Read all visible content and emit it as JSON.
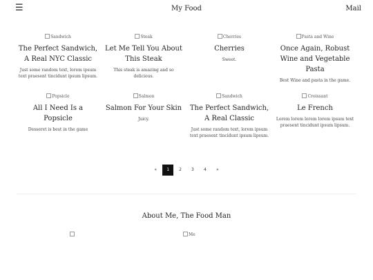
{
  "header": {
    "menu_icon": "☰",
    "site_title": "My Food",
    "mail_label": "Mail"
  },
  "posts": [
    {
      "img_alt": "Sandwich",
      "title": "The Perfect Sandwich, A Real NYC Classic",
      "desc": "Just some random text, lorem ipsum text praesent tincidunt ipsum lipsum."
    },
    {
      "img_alt": "Steak",
      "title": "Let Me Tell You About This Steak",
      "desc": "This steak is amazing and so delicious."
    },
    {
      "img_alt": "Cherries",
      "title": "Cherries",
      "desc": "Sweet."
    },
    {
      "img_alt": "Pasta and Wine",
      "title": "Once Again, Robust Wine and Vegetable Pasta",
      "desc": "Best Wine and pasta in the game."
    },
    {
      "img_alt": "Popsicle",
      "title": "All I Need Is a Popsicle",
      "desc": "Desseret is best in the game"
    },
    {
      "img_alt": "Salmon",
      "title": "Salmon For Your Skin",
      "desc": "Juicy."
    },
    {
      "img_alt": "Sandwich",
      "title": "The Perfect Sandwich, A Real Classic",
      "desc": "Just some random text, lorem ipsum text praesent tincidunt ipsum lipsum."
    },
    {
      "img_alt": "Croissant",
      "title": "Le French",
      "desc": "Lorem lorem lorem lorem ipsum text praesent tincidunt ipsum lipsum."
    }
  ],
  "pagination": {
    "prev": "«",
    "pages": [
      "1",
      "2",
      "3",
      "4"
    ],
    "active_page": "1",
    "next": "»"
  },
  "about": {
    "title": "About Me, The Food Man",
    "img_alt_left": "",
    "img_alt_right": "Me"
  }
}
